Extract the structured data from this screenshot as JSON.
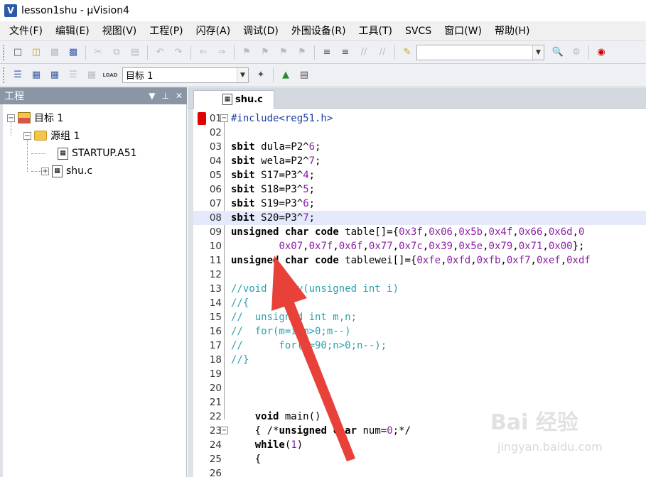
{
  "window": {
    "title": "lesson1shu  - µVision4",
    "app_icon_letter": "V"
  },
  "menu": [
    "文件(F)",
    "编辑(E)",
    "视图(V)",
    "工程(P)",
    "闪存(A)",
    "调试(D)",
    "外围设备(R)",
    "工具(T)",
    "SVCS",
    "窗口(W)",
    "帮助(H)"
  ],
  "toolbar2": {
    "target_combo_value": "目标 1",
    "load_label": "LOAD"
  },
  "project_panel": {
    "title": "工程",
    "tree": {
      "target": "目标 1",
      "group": "源组 1",
      "files": [
        "STARTUP.A51",
        "shu.c"
      ]
    }
  },
  "editor": {
    "tab_label": "shu.c",
    "lines": [
      {
        "n": "01",
        "code": "#include<reg51.h>"
      },
      {
        "n": "02",
        "code": ""
      },
      {
        "n": "03",
        "code": "sbit dula=P2^6;"
      },
      {
        "n": "04",
        "code": "sbit wela=P2^7;"
      },
      {
        "n": "05",
        "code": "sbit S17=P3^4;"
      },
      {
        "n": "06",
        "code": "sbit S18=P3^5;"
      },
      {
        "n": "07",
        "code": "sbit S19=P3^6;"
      },
      {
        "n": "08",
        "code": "sbit S20=P3^7;"
      },
      {
        "n": "09",
        "code": "unsigned char code table[]={0x3f,0x06,0x5b,0x4f,0x66,0x6d,0"
      },
      {
        "n": "10",
        "code": "        0x07,0x7f,0x6f,0x77,0x7c,0x39,0x5e,0x79,0x71,0x00};"
      },
      {
        "n": "11",
        "code": "unsigned char code tablewei[]={0xfe,0xfd,0xfb,0xf7,0xef,0xdf"
      },
      {
        "n": "12",
        "code": ""
      },
      {
        "n": "13",
        "code": "//void delay(unsigned int i)"
      },
      {
        "n": "14",
        "code": "//{"
      },
      {
        "n": "15",
        "code": "//  unsigned int m,n;"
      },
      {
        "n": "16",
        "code": "//  for(m=i;m>0;m--)"
      },
      {
        "n": "17",
        "code": "//      for(n=90;n>0;n--);"
      },
      {
        "n": "18",
        "code": "//}"
      },
      {
        "n": "19",
        "code": ""
      },
      {
        "n": "20",
        "code": ""
      },
      {
        "n": "21",
        "code": ""
      },
      {
        "n": "22",
        "code": "    void main()"
      },
      {
        "n": "23",
        "code": "    { /*unsigned char num=0;*/"
      },
      {
        "n": "24",
        "code": "    while(1)"
      },
      {
        "n": "25",
        "code": "    {"
      },
      {
        "n": "26",
        "code": ""
      }
    ]
  },
  "watermark": {
    "main": "Bai 经验",
    "sub": "jingyan.baidu.com"
  },
  "colors": {
    "breakpoint": "#e00000",
    "comment": "#2aa1b0",
    "number": "#8b1fa5",
    "preprocessor": "#1c3fa0",
    "annotation_arrow": "#e8413a",
    "panel_header": "#8a96a6",
    "highlight_line": "#e4e9fb"
  }
}
